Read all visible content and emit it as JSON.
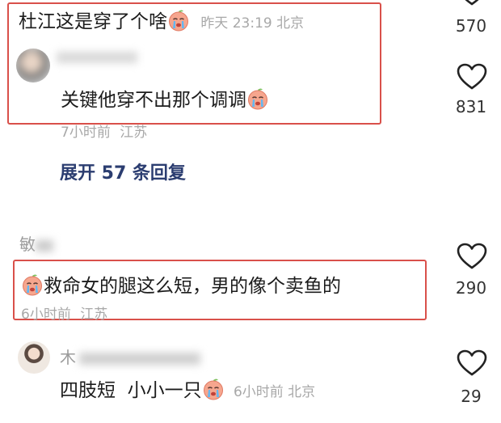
{
  "comment1": {
    "text": "杜江这是穿了个啥",
    "time": "昨天 23:19",
    "location": "北京",
    "like_count": "570"
  },
  "reply1": {
    "text": "关键他穿不出那个调调",
    "time": "7小时前",
    "location": "江苏",
    "like_count": "831"
  },
  "expand_replies": "展开 57 条回复",
  "comment2": {
    "username": "敏",
    "text": "救命女的腿这么短，男的像个卖鱼的",
    "time": "6小时前",
    "location": "江苏",
    "like_count": "290"
  },
  "reply2": {
    "username": "木",
    "text": "四肢短  小小一只",
    "time": "6小时前",
    "location": "北京",
    "like_count": "29"
  },
  "colors": {
    "highlight_border": "#d9504a",
    "expand_link": "#2b3d70",
    "meta_gray": "#a8a8a8"
  }
}
